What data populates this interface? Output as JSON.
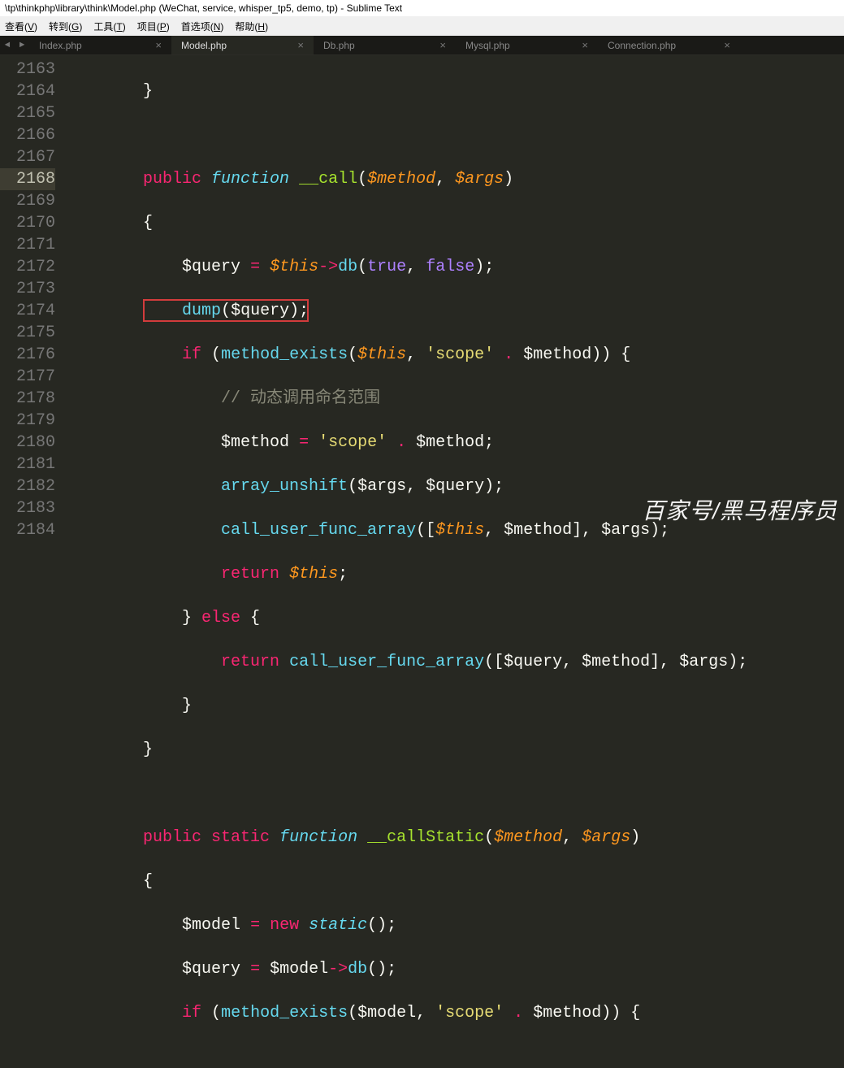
{
  "title": "\\tp\\thinkphp\\library\\think\\Model.php (WeChat, service, whisper_tp5, demo, tp) - Sublime Text",
  "menu": {
    "view": "查看(V)",
    "goto": "转到(G)",
    "tools": "工具(T)",
    "project": "项目(P)",
    "prefs": "首选项(N)",
    "help": "帮助(H)"
  },
  "nav": {
    "back": "◄",
    "fwd": "►"
  },
  "tabs": [
    {
      "label": "Index.php"
    },
    {
      "label": "Model.php"
    },
    {
      "label": "Db.php"
    },
    {
      "label": "Mysql.php"
    },
    {
      "label": "Connection.php"
    }
  ],
  "close_glyph": "×",
  "line_numbers": [
    "2163",
    "2164",
    "2165",
    "2166",
    "2167",
    "2168",
    "2169",
    "2170",
    "2171",
    "2172",
    "2173",
    "2174",
    "2175",
    "2176",
    "2177",
    "2178",
    "2179",
    "2180",
    "2181",
    "2182",
    "2183",
    "2184"
  ],
  "code": {
    "l2163": "        }",
    "l2165_public": "public",
    "l2165_function": "function",
    "l2165_name": "__call",
    "l2165_method": "$method",
    "l2165_args": "$args",
    "l2166": "        {",
    "l2167_q": "$query",
    "l2167_this": "$this",
    "l2167_db": "db",
    "l2167_true": "true",
    "l2167_false": "false",
    "l2168_dump": "dump",
    "l2168_q": "$query",
    "l2169_if": "if",
    "l2169_me": "method_exists",
    "l2169_this": "$this",
    "l2169_str": "'scope'",
    "l2169_m": "$method",
    "l2170_cm": "// 动态调用命名范围",
    "l2171_m": "$method",
    "l2171_str": "'scope'",
    "l2171_m2": "$method",
    "l2172_au": "array_unshift",
    "l2172_a": "$args",
    "l2172_q": "$query",
    "l2173_cu": "call_user_func_array",
    "l2173_this": "$this",
    "l2173_m": "$method",
    "l2173_a": "$args",
    "l2174_ret": "return",
    "l2174_this": "$this",
    "l2175": "            } ",
    "l2175_else": "else",
    "l2175_b": " {",
    "l2176_ret": "return",
    "l2176_cu": "call_user_func_array",
    "l2176_q": "$query",
    "l2176_m": "$method",
    "l2176_a": "$args",
    "l2177": "            }",
    "l2178": "        }",
    "l2180_public": "public",
    "l2180_static": "static",
    "l2180_function": "function",
    "l2180_name": "__callStatic",
    "l2180_method": "$method",
    "l2180_args": "$args",
    "l2181": "        {",
    "l2182_m": "$model",
    "l2182_new": "new",
    "l2182_static": "static",
    "l2183_q": "$query",
    "l2183_m": "$model",
    "l2183_db": "db",
    "l2184_if": "if",
    "l2184_me": "method_exists",
    "l2184_m": "$model",
    "l2184_str": "'scope'",
    "l2184_meth": "$method"
  },
  "watermark": "百家号/黑马程序员"
}
